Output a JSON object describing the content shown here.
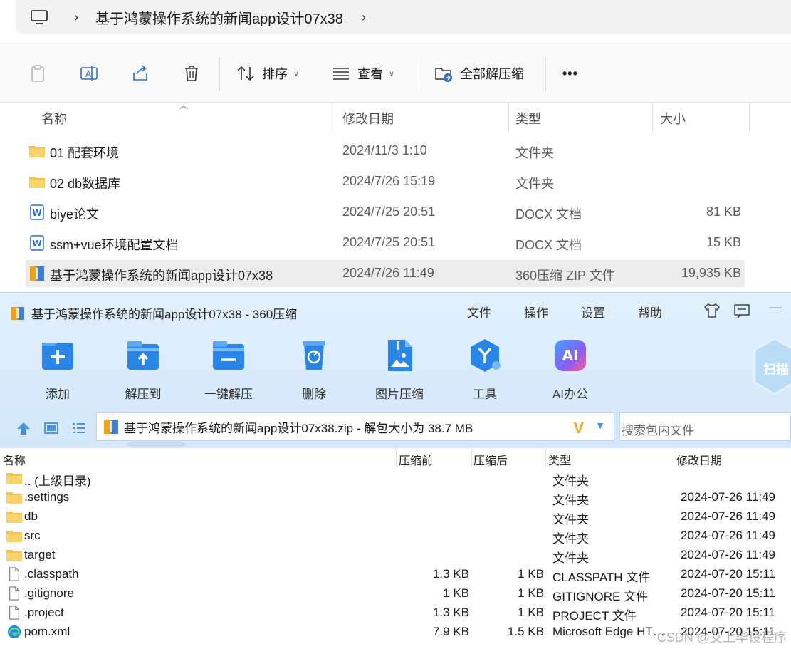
{
  "explorer": {
    "address_path": "基于鸿蒙操作系统的新闻app设计07x38",
    "toolbar": {
      "sort_label": "排序",
      "view_label": "查看",
      "extract_all_label": "全部解压缩",
      "more_label": "•••"
    },
    "columns": {
      "name": "名称",
      "date": "修改日期",
      "type": "类型",
      "size": "大小"
    },
    "rows": [
      {
        "name": "01 配套环境",
        "date": "2024/11/3 1:10",
        "type": "文件夹",
        "size": "",
        "icon": "folder-icon"
      },
      {
        "name": "02 db数据库",
        "date": "2024/7/26 15:19",
        "type": "文件夹",
        "size": "",
        "icon": "folder-icon"
      },
      {
        "name": "biye论文",
        "date": "2024/7/25 20:51",
        "type": "DOCX 文档",
        "size": "81 KB",
        "icon": "word-doc-icon"
      },
      {
        "name": "ssm+vue环境配置文档",
        "date": "2024/7/25 20:51",
        "type": "DOCX 文档",
        "size": "15 KB",
        "icon": "word-doc-icon"
      },
      {
        "name": "基于鸿蒙操作系统的新闻app设计07x38",
        "date": "2024/7/26 11:49",
        "type": "360压缩 ZIP 文件",
        "size": "19,935 KB",
        "icon": "zip-archive-icon"
      }
    ]
  },
  "zip": {
    "title": "基于鸿蒙操作系统的新闻app设计07x38 - 360压缩",
    "menu": {
      "file": "文件",
      "operate": "操作",
      "settings": "设置",
      "help": "帮助",
      "minimize": "—"
    },
    "tools": {
      "add": "添加",
      "extract_to": "解压到",
      "one_click_extract": "一键解压",
      "delete": "删除",
      "image_compress": "图片压缩",
      "tools": "工具",
      "ai_office": "AI办公",
      "ai_badge": "AI",
      "scan_badge": "扫描"
    },
    "path_text": "基于鸿蒙操作系统的新闻app设计07x38.zip - 解包大小为 38.7 MB",
    "search_placeholder": "搜索包内文件",
    "columns": {
      "name": "名称",
      "before": "压缩前",
      "after": "压缩后",
      "type": "类型",
      "date": "修改日期"
    },
    "rows": [
      {
        "name": ".. (上级目录)",
        "before": "",
        "after": "",
        "type": "文件夹",
        "date": "",
        "icon": "folder-icon"
      },
      {
        "name": ".settings",
        "before": "",
        "after": "",
        "type": "文件夹",
        "date": "2024-07-26 11:49",
        "icon": "folder-icon"
      },
      {
        "name": "db",
        "before": "",
        "after": "",
        "type": "文件夹",
        "date": "2024-07-26 11:49",
        "icon": "folder-icon"
      },
      {
        "name": "src",
        "before": "",
        "after": "",
        "type": "文件夹",
        "date": "2024-07-26 11:49",
        "icon": "folder-icon"
      },
      {
        "name": "target",
        "before": "",
        "after": "",
        "type": "文件夹",
        "date": "2024-07-26 11:49",
        "icon": "folder-icon"
      },
      {
        "name": ".classpath",
        "before": "1.3 KB",
        "after": "1 KB",
        "type": "CLASSPATH 文件",
        "date": "2024-07-20 15:11",
        "icon": "file-icon"
      },
      {
        "name": ".gitignore",
        "before": "1 KB",
        "after": "1 KB",
        "type": "GITIGNORE 文件",
        "date": "2024-07-20 15:11",
        "icon": "file-icon"
      },
      {
        "name": ".project",
        "before": "1.3 KB",
        "after": "1 KB",
        "type": "PROJECT 文件",
        "date": "2024-07-20 15:11",
        "icon": "file-icon"
      },
      {
        "name": "pom.xml",
        "before": "7.9 KB",
        "after": "1.5 KB",
        "type": "Microsoft Edge HTML Document",
        "date": "2024-07-20 15:11",
        "icon": "edge-icon"
      }
    ]
  },
  "watermark": "CSDN @艾上毕设程序",
  "colors": {
    "folder": "#f8c44f",
    "accent": "#2f87e8",
    "zip_bg": "#d9ecfb"
  }
}
